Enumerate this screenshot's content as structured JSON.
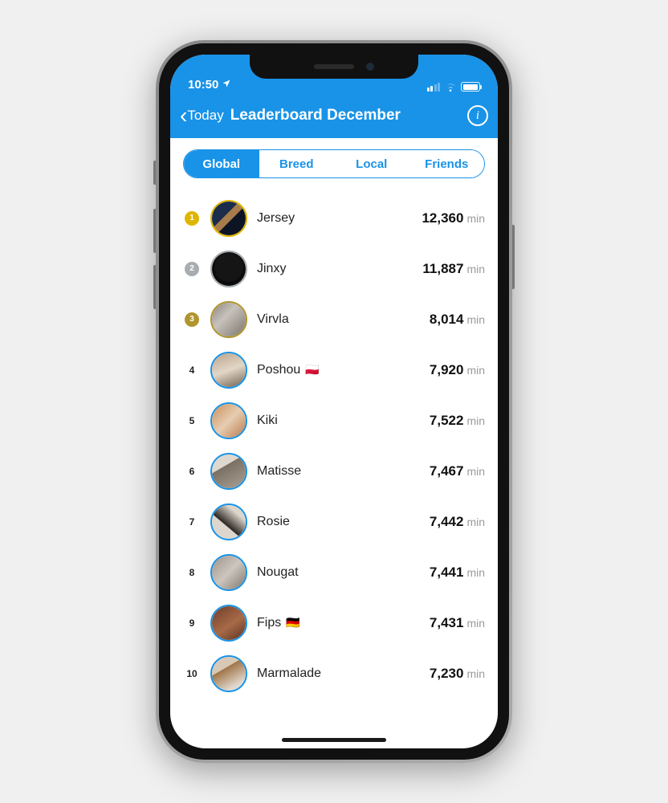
{
  "status": {
    "time": "10:50",
    "location_icon": "location-arrow-icon"
  },
  "nav": {
    "back_label": "Today",
    "title": "Leaderboard December",
    "info_icon": "info-icon"
  },
  "tabs": {
    "items": [
      {
        "label": "Global",
        "active": true
      },
      {
        "label": "Breed",
        "active": false
      },
      {
        "label": "Local",
        "active": false
      },
      {
        "label": "Friends",
        "active": false
      }
    ]
  },
  "unit_label": "min",
  "leaderboard": [
    {
      "rank": 1,
      "name": "Jersey",
      "flag": "",
      "value": "12,360",
      "medal": "gold",
      "avatar_bg": "linear-gradient(135deg,#1b2d4a 40%,#a77c4a 41%,#a77c4a 55%,#0d1524 56%)"
    },
    {
      "rank": 2,
      "name": "Jinxy",
      "flag": "",
      "value": "11,887",
      "medal": "silver",
      "avatar_bg": "radial-gradient(circle at 50% 45%, #151515 0%, #151515 55%, #0b0b0b 60%)"
    },
    {
      "rank": 3,
      "name": "Virvla",
      "flag": "",
      "value": "8,014",
      "medal": "bronze",
      "avatar_bg": "linear-gradient(135deg,#8a857f,#c7c2bb 40%,#7b746c)"
    },
    {
      "rank": 4,
      "name": "Poshou",
      "flag": "🇵🇱",
      "value": "7,920",
      "medal": "",
      "avatar_bg": "linear-gradient(160deg,#b9a38a,#e2d6c7 50%,#6f5e4c)"
    },
    {
      "rank": 5,
      "name": "Kiki",
      "flag": "",
      "value": "7,522",
      "medal": "",
      "avatar_bg": "linear-gradient(135deg,#c88f5b,#e7cdb2 50%,#b8794a)"
    },
    {
      "rank": 6,
      "name": "Matisse",
      "flag": "",
      "value": "7,467",
      "medal": "",
      "avatar_bg": "linear-gradient(150deg,#ded8cf 0%,#ded8cf 35%,#7a6f63 36%,#aaa297)"
    },
    {
      "rank": 7,
      "name": "Rosie",
      "flag": "",
      "value": "7,442",
      "medal": "",
      "avatar_bg": "linear-gradient(40deg,#dcd6cc 0%,#dcd6cc 40%,#2a2521 41%,#dcd6cc 75%)"
    },
    {
      "rank": 8,
      "name": "Nougat",
      "flag": "",
      "value": "7,441",
      "medal": "",
      "avatar_bg": "linear-gradient(135deg,#9b938a,#cdc6be 50%,#7f776d)"
    },
    {
      "rank": 9,
      "name": "Fips",
      "flag": "🇩🇪",
      "value": "7,431",
      "medal": "",
      "avatar_bg": "linear-gradient(145deg,#6f3d29,#a86a47 55%,#5a3221)"
    },
    {
      "rank": 10,
      "name": "Marmalade",
      "flag": "",
      "value": "7,230",
      "medal": "",
      "avatar_bg": "linear-gradient(150deg,#d8c9b7 0%,#d8c9b7 35%,#a07448 36%,#e1d8cd 80%)"
    }
  ]
}
